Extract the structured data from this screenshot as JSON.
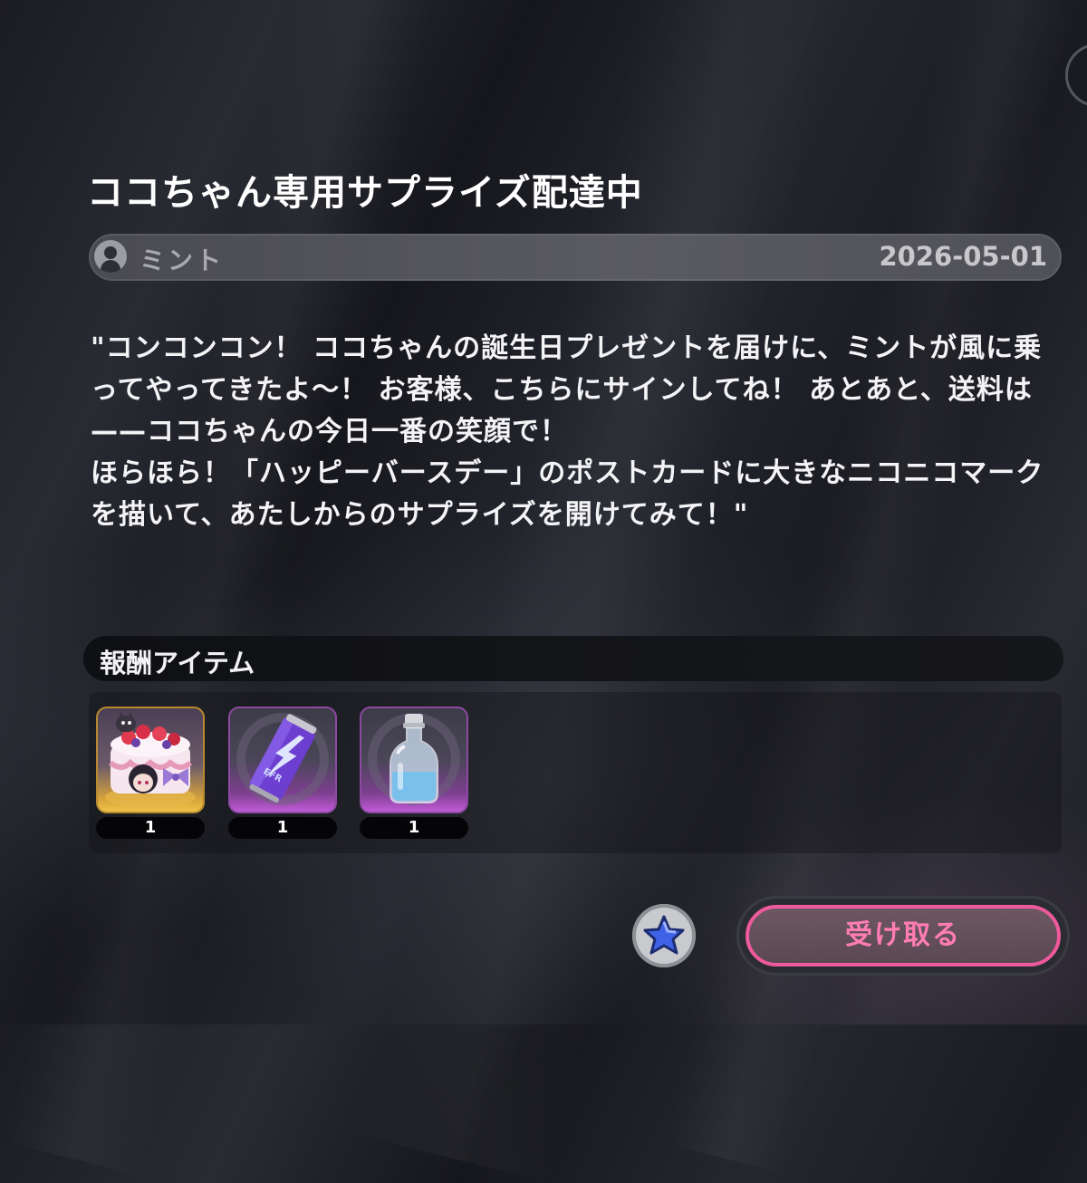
{
  "mail": {
    "title": "ココちゃん専用サプライズ配達中",
    "sender": {
      "name": "ミント",
      "date": "2026-05-01"
    },
    "message": {
      "line1": "\"コンコンコン！ ココちゃんの誕生日プレゼントを届けに、ミントが風に乗ってやってきたよ～！ お客様、こちらにサインしてね！ あとあと、送料は——ココちゃんの今日一番の笑顔で！",
      "line2": "ほらほら！「ハッピーバースデー」のポストカードに大きなニコニコマークを描いて、あたしからのサプライズを開けてみて！\""
    }
  },
  "rewards": {
    "header": "報酬アイテム",
    "items": [
      {
        "name": "birthday-cake",
        "icon": "cake-icon",
        "quantity": "1"
      },
      {
        "name": "energy-drink",
        "icon": "energy-drink-can-icon",
        "quantity": "1"
      },
      {
        "name": "potion-bottle",
        "icon": "bottle-icon",
        "quantity": "1"
      }
    ]
  },
  "actions": {
    "claim_label": "受け取る",
    "favorite_icon": "star-icon"
  },
  "colors": {
    "accent_pink": "#ef5a9d",
    "claim_text": "#ff7db3",
    "purple_rarity": "#c15ad8",
    "gold_rarity": "#f0c24a"
  }
}
